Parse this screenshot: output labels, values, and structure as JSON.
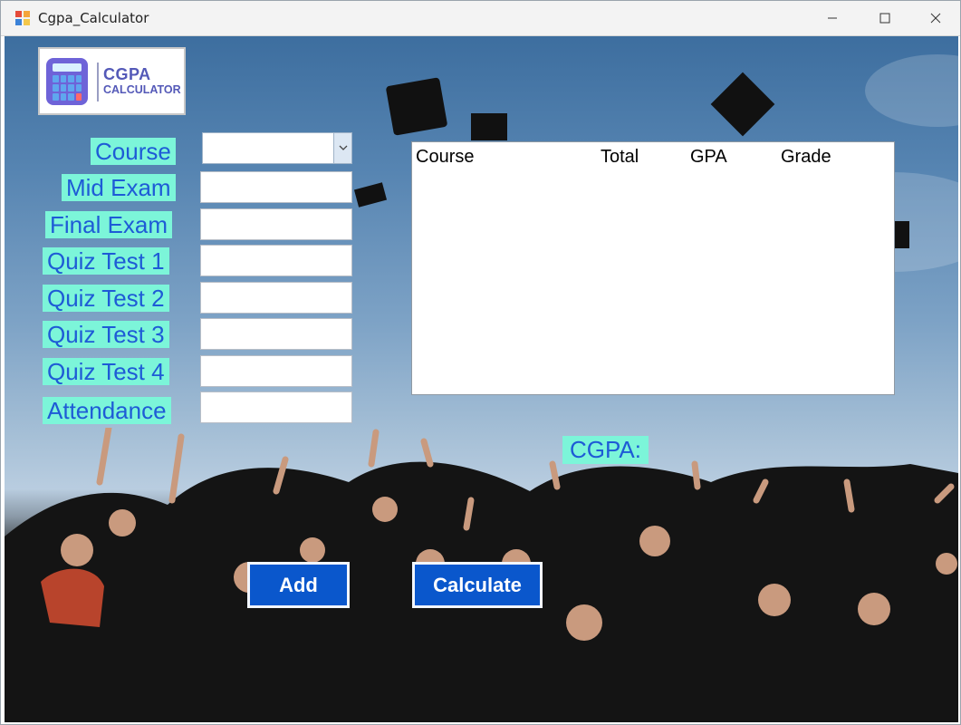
{
  "window": {
    "title": "Cgpa_Calculator"
  },
  "logo": {
    "line1": "CGPA",
    "line2": "CALCULATOR"
  },
  "form": {
    "course_label": "Course",
    "course_value": "",
    "mid_label": "Mid Exam",
    "mid_value": "",
    "final_label": "Final Exam",
    "final_value": "",
    "quiz1_label": "Quiz Test 1",
    "quiz1_value": "",
    "quiz2_label": "Quiz Test 2",
    "quiz2_value": "",
    "quiz3_label": "Quiz Test 3",
    "quiz3_value": "",
    "quiz4_label": "Quiz Test 4",
    "quiz4_value": "",
    "attendance_label": "Attendance",
    "attendance_value": ""
  },
  "results": {
    "columns": [
      "Course",
      "Total",
      "GPA",
      "Grade"
    ],
    "rows": []
  },
  "cgpa_label": "CGPA:",
  "buttons": {
    "add": "Add",
    "calculate": "Calculate"
  },
  "colors": {
    "label_bg": "#7cf5d9",
    "label_text": "#1e5bd6",
    "button_bg": "#0a57cc"
  },
  "icons": {
    "app": "calculator-app-icon",
    "minimize": "minimize-icon",
    "maximize": "maximize-icon",
    "close": "close-icon",
    "dropdown": "chevron-down-icon"
  }
}
